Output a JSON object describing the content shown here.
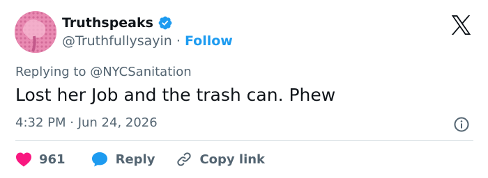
{
  "author": {
    "name": "Truthspeaks",
    "handle": "@Truthfullysayin",
    "separator": "·",
    "follow_label": "Follow"
  },
  "tweet": {
    "reply_to": "Replying to @NYCSanitation",
    "text": "Lost her Job and the trash can. Phew",
    "timestamp": "4:32 PM · Jun 24, 2026"
  },
  "actions": {
    "like_count": "961",
    "reply_label": "Reply",
    "copy_link_label": "Copy link"
  },
  "colors": {
    "accent": "#1d9bf0",
    "like": "#f91880",
    "text": "#0f1419",
    "secondary": "#536471",
    "divider": "#cfd9de"
  },
  "icons": [
    "verified-badge-icon",
    "x-logo-icon",
    "info-icon",
    "heart-icon",
    "reply-bubble-icon",
    "link-icon"
  ]
}
